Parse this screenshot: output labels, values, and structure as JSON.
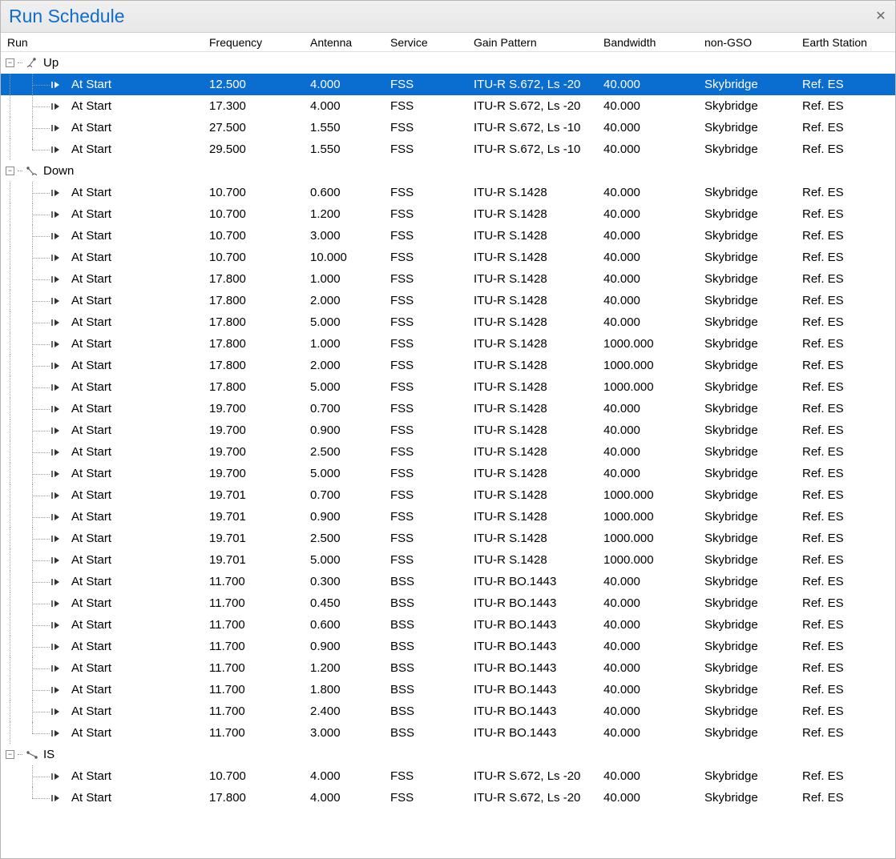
{
  "title": "Run Schedule",
  "columns": {
    "run": "Run",
    "frequency": "Frequency",
    "antenna": "Antenna",
    "service": "Service",
    "gain": "Gain Pattern",
    "bandwidth": "Bandwidth",
    "ngso": "non-GSO",
    "es": "Earth Station"
  },
  "groups": [
    {
      "label": "Up",
      "icon": "uplink-icon",
      "rows": [
        {
          "run": "At Start",
          "freq": "12.500",
          "ant": "4.000",
          "serv": "FSS",
          "gain": "ITU-R S.672, Ls -20",
          "bw": "40.000",
          "ngso": "Skybridge",
          "es": "Ref. ES",
          "selected": true
        },
        {
          "run": "At Start",
          "freq": "17.300",
          "ant": "4.000",
          "serv": "FSS",
          "gain": "ITU-R S.672, Ls -20",
          "bw": "40.000",
          "ngso": "Skybridge",
          "es": "Ref. ES"
        },
        {
          "run": "At Start",
          "freq": "27.500",
          "ant": "1.550",
          "serv": "FSS",
          "gain": "ITU-R S.672, Ls -10",
          "bw": "40.000",
          "ngso": "Skybridge",
          "es": "Ref. ES"
        },
        {
          "run": "At Start",
          "freq": "29.500",
          "ant": "1.550",
          "serv": "FSS",
          "gain": "ITU-R S.672, Ls -10",
          "bw": "40.000",
          "ngso": "Skybridge",
          "es": "Ref. ES"
        }
      ]
    },
    {
      "label": "Down",
      "icon": "downlink-icon",
      "rows": [
        {
          "run": "At Start",
          "freq": "10.700",
          "ant": "0.600",
          "serv": "FSS",
          "gain": "ITU-R S.1428",
          "bw": "40.000",
          "ngso": "Skybridge",
          "es": "Ref. ES"
        },
        {
          "run": "At Start",
          "freq": "10.700",
          "ant": "1.200",
          "serv": "FSS",
          "gain": "ITU-R S.1428",
          "bw": "40.000",
          "ngso": "Skybridge",
          "es": "Ref. ES"
        },
        {
          "run": "At Start",
          "freq": "10.700",
          "ant": "3.000",
          "serv": "FSS",
          "gain": "ITU-R S.1428",
          "bw": "40.000",
          "ngso": "Skybridge",
          "es": "Ref. ES"
        },
        {
          "run": "At Start",
          "freq": "10.700",
          "ant": "10.000",
          "serv": "FSS",
          "gain": "ITU-R S.1428",
          "bw": "40.000",
          "ngso": "Skybridge",
          "es": "Ref. ES"
        },
        {
          "run": "At Start",
          "freq": "17.800",
          "ant": "1.000",
          "serv": "FSS",
          "gain": "ITU-R S.1428",
          "bw": "40.000",
          "ngso": "Skybridge",
          "es": "Ref. ES"
        },
        {
          "run": "At Start",
          "freq": "17.800",
          "ant": "2.000",
          "serv": "FSS",
          "gain": "ITU-R S.1428",
          "bw": "40.000",
          "ngso": "Skybridge",
          "es": "Ref. ES"
        },
        {
          "run": "At Start",
          "freq": "17.800",
          "ant": "5.000",
          "serv": "FSS",
          "gain": "ITU-R S.1428",
          "bw": "40.000",
          "ngso": "Skybridge",
          "es": "Ref. ES"
        },
        {
          "run": "At Start",
          "freq": "17.800",
          "ant": "1.000",
          "serv": "FSS",
          "gain": "ITU-R S.1428",
          "bw": "1000.000",
          "ngso": "Skybridge",
          "es": "Ref. ES"
        },
        {
          "run": "At Start",
          "freq": "17.800",
          "ant": "2.000",
          "serv": "FSS",
          "gain": "ITU-R S.1428",
          "bw": "1000.000",
          "ngso": "Skybridge",
          "es": "Ref. ES"
        },
        {
          "run": "At Start",
          "freq": "17.800",
          "ant": "5.000",
          "serv": "FSS",
          "gain": "ITU-R S.1428",
          "bw": "1000.000",
          "ngso": "Skybridge",
          "es": "Ref. ES"
        },
        {
          "run": "At Start",
          "freq": "19.700",
          "ant": "0.700",
          "serv": "FSS",
          "gain": "ITU-R S.1428",
          "bw": "40.000",
          "ngso": "Skybridge",
          "es": "Ref. ES"
        },
        {
          "run": "At Start",
          "freq": "19.700",
          "ant": "0.900",
          "serv": "FSS",
          "gain": "ITU-R S.1428",
          "bw": "40.000",
          "ngso": "Skybridge",
          "es": "Ref. ES"
        },
        {
          "run": "At Start",
          "freq": "19.700",
          "ant": "2.500",
          "serv": "FSS",
          "gain": "ITU-R S.1428",
          "bw": "40.000",
          "ngso": "Skybridge",
          "es": "Ref. ES"
        },
        {
          "run": "At Start",
          "freq": "19.700",
          "ant": "5.000",
          "serv": "FSS",
          "gain": "ITU-R S.1428",
          "bw": "40.000",
          "ngso": "Skybridge",
          "es": "Ref. ES"
        },
        {
          "run": "At Start",
          "freq": "19.701",
          "ant": "0.700",
          "serv": "FSS",
          "gain": "ITU-R S.1428",
          "bw": "1000.000",
          "ngso": "Skybridge",
          "es": "Ref. ES"
        },
        {
          "run": "At Start",
          "freq": "19.701",
          "ant": "0.900",
          "serv": "FSS",
          "gain": "ITU-R S.1428",
          "bw": "1000.000",
          "ngso": "Skybridge",
          "es": "Ref. ES"
        },
        {
          "run": "At Start",
          "freq": "19.701",
          "ant": "2.500",
          "serv": "FSS",
          "gain": "ITU-R S.1428",
          "bw": "1000.000",
          "ngso": "Skybridge",
          "es": "Ref. ES"
        },
        {
          "run": "At Start",
          "freq": "19.701",
          "ant": "5.000",
          "serv": "FSS",
          "gain": "ITU-R S.1428",
          "bw": "1000.000",
          "ngso": "Skybridge",
          "es": "Ref. ES"
        },
        {
          "run": "At Start",
          "freq": "11.700",
          "ant": "0.300",
          "serv": "BSS",
          "gain": "ITU-R BO.1443",
          "bw": "40.000",
          "ngso": "Skybridge",
          "es": "Ref. ES"
        },
        {
          "run": "At Start",
          "freq": "11.700",
          "ant": "0.450",
          "serv": "BSS",
          "gain": "ITU-R BO.1443",
          "bw": "40.000",
          "ngso": "Skybridge",
          "es": "Ref. ES"
        },
        {
          "run": "At Start",
          "freq": "11.700",
          "ant": "0.600",
          "serv": "BSS",
          "gain": "ITU-R BO.1443",
          "bw": "40.000",
          "ngso": "Skybridge",
          "es": "Ref. ES"
        },
        {
          "run": "At Start",
          "freq": "11.700",
          "ant": "0.900",
          "serv": "BSS",
          "gain": "ITU-R BO.1443",
          "bw": "40.000",
          "ngso": "Skybridge",
          "es": "Ref. ES"
        },
        {
          "run": "At Start",
          "freq": "11.700",
          "ant": "1.200",
          "serv": "BSS",
          "gain": "ITU-R BO.1443",
          "bw": "40.000",
          "ngso": "Skybridge",
          "es": "Ref. ES"
        },
        {
          "run": "At Start",
          "freq": "11.700",
          "ant": "1.800",
          "serv": "BSS",
          "gain": "ITU-R BO.1443",
          "bw": "40.000",
          "ngso": "Skybridge",
          "es": "Ref. ES"
        },
        {
          "run": "At Start",
          "freq": "11.700",
          "ant": "2.400",
          "serv": "BSS",
          "gain": "ITU-R BO.1443",
          "bw": "40.000",
          "ngso": "Skybridge",
          "es": "Ref. ES"
        },
        {
          "run": "At Start",
          "freq": "11.700",
          "ant": "3.000",
          "serv": "BSS",
          "gain": "ITU-R BO.1443",
          "bw": "40.000",
          "ngso": "Skybridge",
          "es": "Ref. ES"
        }
      ]
    },
    {
      "label": "IS",
      "icon": "intersat-icon",
      "rows": [
        {
          "run": "At Start",
          "freq": "10.700",
          "ant": "4.000",
          "serv": "FSS",
          "gain": "ITU-R S.672, Ls -20",
          "bw": "40.000",
          "ngso": "Skybridge",
          "es": "Ref. ES"
        },
        {
          "run": "At Start",
          "freq": "17.800",
          "ant": "4.000",
          "serv": "FSS",
          "gain": "ITU-R S.672, Ls -20",
          "bw": "40.000",
          "ngso": "Skybridge",
          "es": "Ref. ES"
        }
      ]
    }
  ],
  "expander_glyph": "−"
}
